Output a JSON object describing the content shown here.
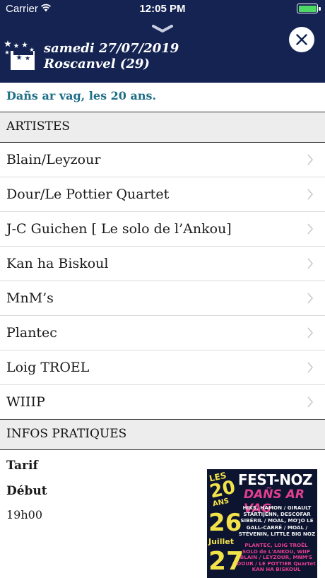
{
  "status_bar": {
    "carrier": "Carrier",
    "time": "12:05 PM"
  },
  "header": {
    "date": "samedi 27/07/2019",
    "place": "Roscanvel (29)"
  },
  "subtitle": "Dañs ar vag, les 20 ans.",
  "artists_section": {
    "title": "ARTISTES",
    "items": [
      "Blain/Leyzour",
      "Dour/Le Pottier Quartet",
      "J-C Guichen [ Le solo de l’Ankou]",
      "Kan ha Biskoul",
      "MnM’s",
      "Plantec",
      "Loig TROEL",
      "WIIIP"
    ]
  },
  "info_section": {
    "title": "INFOS PRATIQUES",
    "tarif_label": "Tarif",
    "debut_label": "Début",
    "debut_value": "19h00"
  },
  "poster": {
    "les": "LES",
    "twenty": "20",
    "ans": "ANS",
    "title": "FEST-NOZ",
    "subtitle": "DAÑS AR VAG",
    "day": "26",
    "month": "Juillet",
    "day2": "27",
    "lineup_26": "HIKS, HAMON / GIRAULT STARTIJENN, DESCOFAR SIBÉRIL / MOAL, MO'JO LE GALL-CARRÉ / MOAL / STÉVENIN, LITTLE BIG NOZ",
    "lineup_27": "PLANTEC, LOIG TROËL SOLO de L'ANKOU, WIIP BLAIN / LEYZOUR, MNM'S DOUR / LE POTTIER Quartet KAN HA BISKOUL"
  },
  "colors": {
    "header_bg": "#142352",
    "accent": "#1f6e88",
    "battery": "#4cd964"
  }
}
